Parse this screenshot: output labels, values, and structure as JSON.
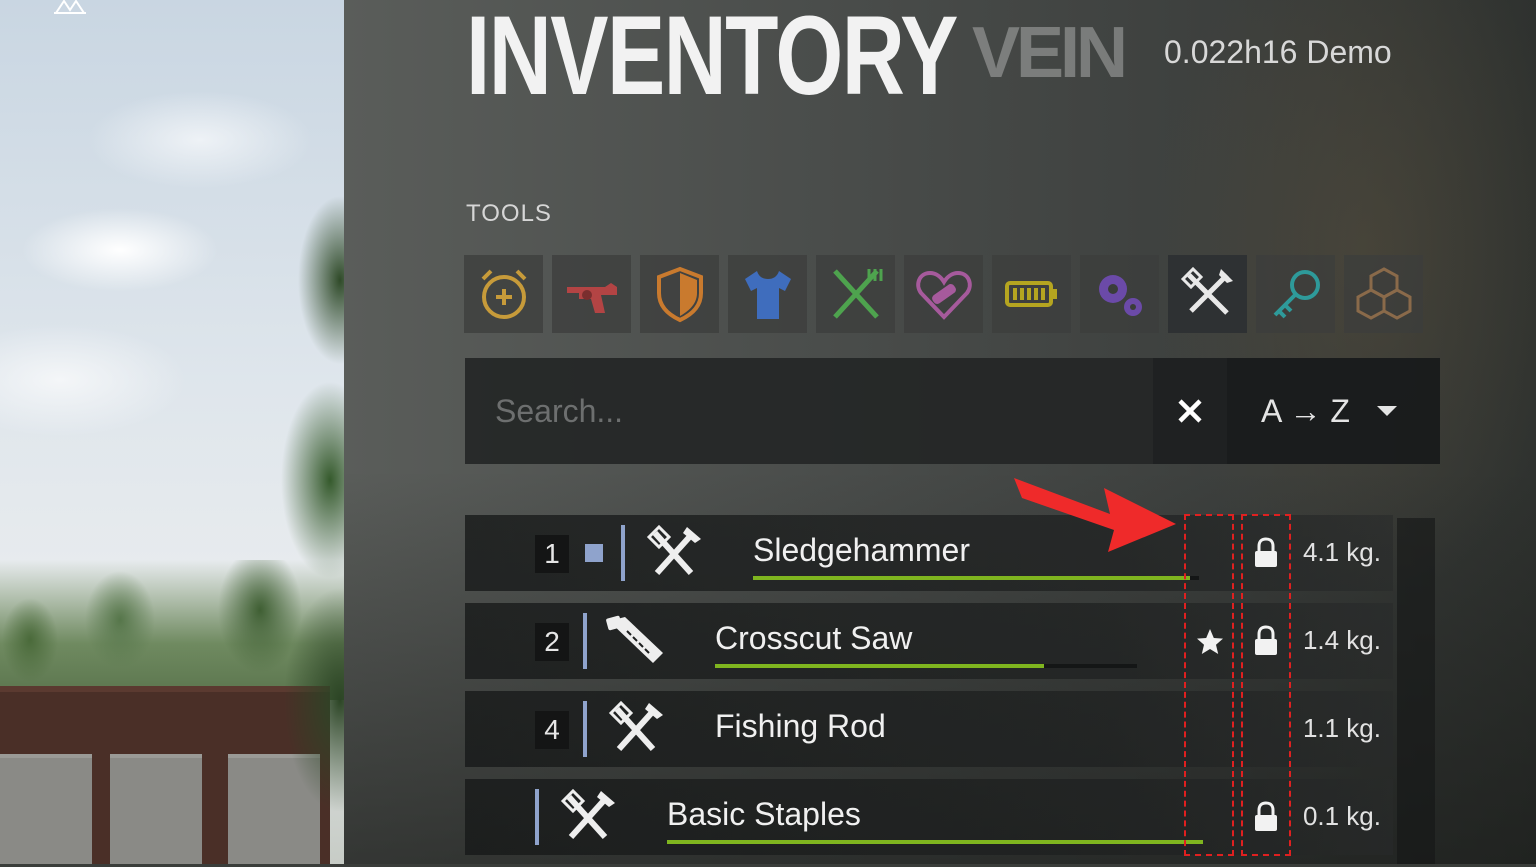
{
  "header": {
    "title": "INVENTORY",
    "title_ghost": "VEIN",
    "version": "0.022h16 Demo"
  },
  "section": {
    "label": "TOOLS"
  },
  "tabs": [
    {
      "icon": "alarm-clock-icon",
      "color": "#c79b3a"
    },
    {
      "icon": "revolver-icon",
      "color": "#b34444"
    },
    {
      "icon": "shield-icon",
      "color": "#c97a2e"
    },
    {
      "icon": "tshirt-icon",
      "color": "#3f6dbd"
    },
    {
      "icon": "fork-knife-icon",
      "color": "#4ea34e"
    },
    {
      "icon": "bandaged-heart-icon",
      "color": "#a65a9c"
    },
    {
      "icon": "battery-icon",
      "color": "#b5a520"
    },
    {
      "icon": "gears-icon",
      "color": "#6b4aa8"
    },
    {
      "icon": "hammer-wrench-icon",
      "color": "#e8e8e8",
      "active": true
    },
    {
      "icon": "key-icon",
      "color": "#2e9a9a"
    },
    {
      "icon": "boxes-icon",
      "color": "#8a6a4a"
    }
  ],
  "search": {
    "placeholder": "Search...",
    "value": ""
  },
  "sort": {
    "label": "A → Z"
  },
  "items": [
    {
      "slot": "1",
      "name": "Sledgehammer",
      "icon": "hammer-wrench-icon",
      "weight": "4.1 kg.",
      "condition": 0.98,
      "favorite": false,
      "locked": true
    },
    {
      "slot": "2",
      "name": "Crosscut Saw",
      "icon": "saw-icon",
      "weight": "1.4 kg.",
      "condition": 0.78,
      "favorite": true,
      "locked": true
    },
    {
      "slot": "4",
      "name": "Fishing Rod",
      "icon": "hammer-wrench-icon",
      "weight": "1.1 kg.",
      "favorite": false,
      "locked": false
    },
    {
      "slot": "",
      "name": "Basic Staples",
      "icon": "hammer-wrench-icon",
      "weight": "0.1 kg.",
      "condition": 1.0,
      "favorite": false,
      "locked": true
    }
  ],
  "colors": {
    "condition_bar": "#7fb51f",
    "accent_marker": "#8fa3cc",
    "annotation": "#e02020"
  }
}
